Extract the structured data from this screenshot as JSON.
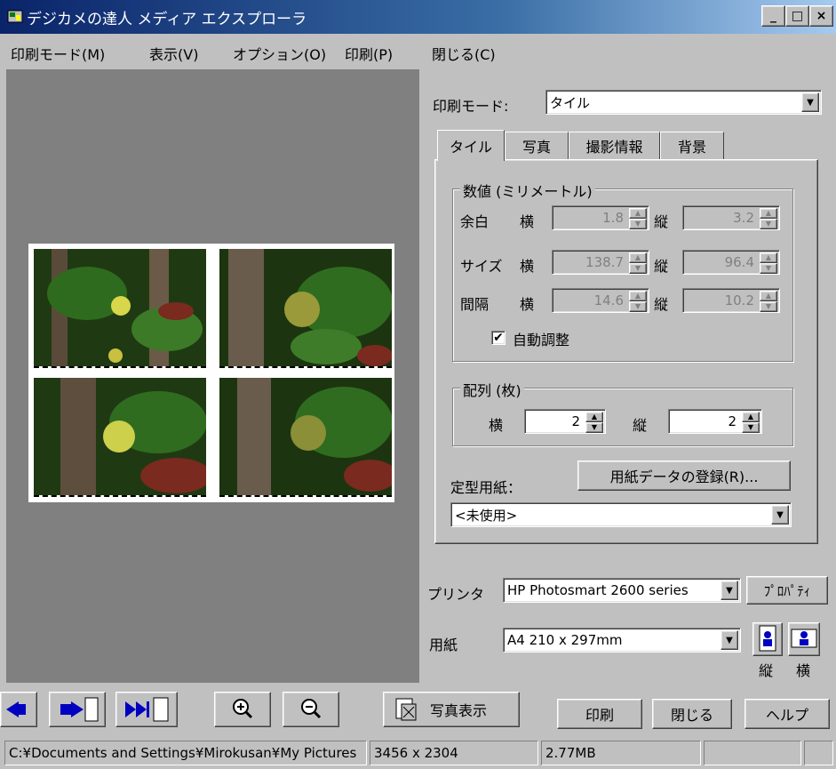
{
  "window": {
    "title": "デジカメの達人 メディア エクスプローラ",
    "min": "_",
    "max": "□",
    "close": "×"
  },
  "menu": [
    "印刷モード(M)",
    "表示(V)",
    "オプション(O)",
    "印刷(P)",
    "閉じる(C)"
  ],
  "print_mode": {
    "label": "印刷モード:",
    "value": "タイル"
  },
  "tabs": [
    "タイル",
    "写真",
    "撮影情報",
    "背景"
  ],
  "numbers": {
    "title": "数値 (ミリメートル)",
    "rows": [
      {
        "label": "余白",
        "h_label": "横",
        "h": "1.8",
        "v_label": "縦",
        "v": "3.2"
      },
      {
        "label": "サイズ",
        "h_label": "横",
        "h": "138.7",
        "v_label": "縦",
        "v": "96.4"
      },
      {
        "label": "間隔",
        "h_label": "横",
        "h": "14.6",
        "v_label": "縦",
        "v": "10.2"
      }
    ],
    "auto_adjust": "自動調整",
    "auto_adjust_checked": true
  },
  "layout": {
    "title": "配列 (枚)",
    "h_label": "横",
    "h": "2",
    "v_label": "縦",
    "v": "2"
  },
  "paper_preset": {
    "label": "定型用紙：",
    "register_button": "用紙データの登録(R)...",
    "value": "<未使用>"
  },
  "printer": {
    "label": "プリンタ",
    "value": "HP Photosmart 2600 series",
    "properties_button": "ﾌﾟﾛﾊﾟﾃｨ"
  },
  "paper": {
    "label": "用紙",
    "value": "A4 210 x 297mm",
    "portrait": "縦",
    "landscape": "横"
  },
  "toolbar": {
    "show_photo": "写真表示"
  },
  "buttons": {
    "print": "印刷",
    "close": "閉じる",
    "help": "ヘルプ"
  },
  "status": {
    "path": "C:¥Documents and Settings¥Mirokusan¥My Pictures",
    "dimensions": "3456 x 2304",
    "size": "2.77MB"
  },
  "colors": {
    "title_start": "#0a246a",
    "title_end": "#a6caf0",
    "preview_bg": "#808080",
    "face": "#c0c0c0"
  }
}
